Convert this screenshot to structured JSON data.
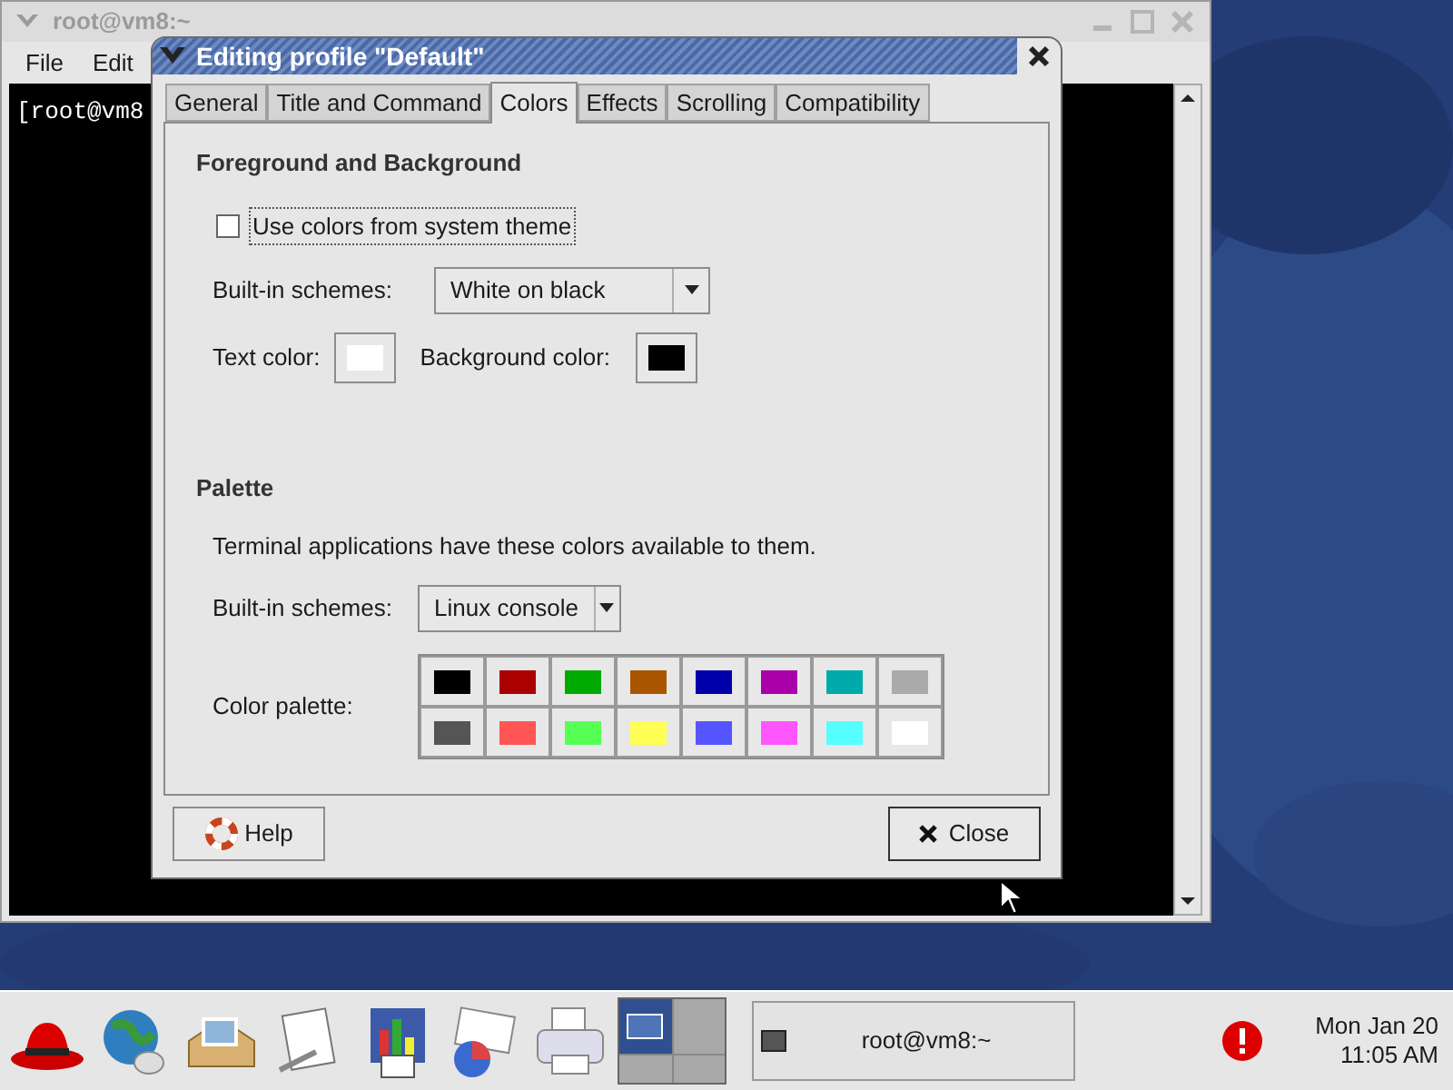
{
  "terminal": {
    "title": "root@vm8:~",
    "menu": [
      "File",
      "Edit"
    ],
    "lines": [
      "[root@vm8"
    ]
  },
  "dialog": {
    "title": "Editing profile \"Default\"",
    "tabs": [
      {
        "label": "General",
        "selected": false
      },
      {
        "label": "Title and Command",
        "selected": false
      },
      {
        "label": "Colors",
        "selected": true
      },
      {
        "label": "Effects",
        "selected": false
      },
      {
        "label": "Scrolling",
        "selected": false
      },
      {
        "label": "Compatibility",
        "selected": false
      }
    ],
    "foreground": {
      "heading": "Foreground and Background",
      "checkbox": {
        "label": "Use colors from system theme",
        "checked": false
      },
      "schemes_label": "Built-in schemes:",
      "scheme": "White on black",
      "color_buttons": [
        {
          "label": "Text color:",
          "color": "#ffffff"
        },
        {
          "label": "Background color:",
          "color": "#000000"
        }
      ]
    },
    "palette": {
      "heading": "Palette",
      "description": "Terminal applications have these colors available to them.",
      "schemes_label": "Built-in schemes:",
      "scheme": "Linux console",
      "palette_label": "Color palette:",
      "colors": [
        {
          "color": "#000000"
        },
        {
          "color": "#aa0000"
        },
        {
          "color": "#00aa00"
        },
        {
          "color": "#aa5500"
        },
        {
          "color": "#0000aa"
        },
        {
          "color": "#aa00aa"
        },
        {
          "color": "#00aaaa"
        },
        {
          "color": "#aaaaaa"
        },
        {
          "color": "#555555"
        },
        {
          "color": "#ff5555"
        },
        {
          "color": "#55ff55"
        },
        {
          "color": "#ffff55"
        },
        {
          "color": "#5555ff"
        },
        {
          "color": "#ff55ff"
        },
        {
          "color": "#55ffff"
        },
        {
          "color": "#ffffff"
        }
      ]
    },
    "buttons": {
      "help": "Help",
      "close": "Close"
    }
  },
  "taskbar": {
    "workspaces": [
      {
        "selected": true
      },
      {
        "selected": false
      },
      {
        "selected": false
      },
      {
        "selected": false
      }
    ],
    "task": "root@vm8:~",
    "clock": {
      "date": "Mon Jan 20",
      "time": "11:05 AM"
    }
  }
}
